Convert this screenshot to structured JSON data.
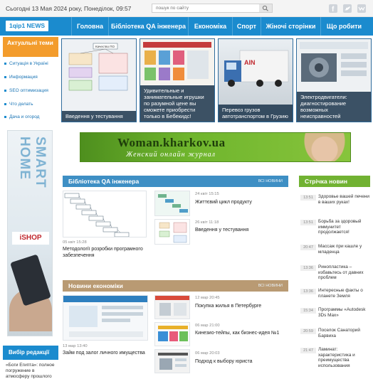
{
  "topbar": {
    "date": "Сьогодні 13 Мая 2024 року, Понеділок, 09:57",
    "search_placeholder": "пошук по сайту"
  },
  "nav": {
    "logo": "1qip1 NEWS",
    "items": [
      "Головна",
      "Бібліотека QA інженера",
      "Економіка",
      "Спорт",
      "Жіночі сторінки",
      "Що робити"
    ]
  },
  "sidebar": {
    "topics_title": "Актуальні теми",
    "topics": [
      "Ситуація в Україні",
      "Информация",
      "SEO оптимизация",
      "Что делать",
      "Дача и огород"
    ],
    "ad_text": "SMART HOME",
    "ad_brand": "iSHOP",
    "editor_title": "Вибір редакції",
    "editor_text": "«Боги Египта»: полное погружение в атмосферу прошлого"
  },
  "featured": [
    {
      "caption": "Введення у тестування",
      "chart_label": "Качество ПО"
    },
    {
      "caption": "Удивительные и занимательные игрушки по разумной цене вы сможете приобрести только в Бебекидс!"
    },
    {
      "caption": "Перевоз грузов автотранспортом в Грузию"
    },
    {
      "caption": "Электродвигатели: диагностирование возможных неисправностей"
    }
  ],
  "banner": {
    "title": "Woman.kharkov.ua",
    "subtitle": "Женский онлайн журнал"
  },
  "qa_section": {
    "title": "Бібліотека QA інженера",
    "all_link": "ВСІ НОВИНИ",
    "main": {
      "meta": "05 квіт 15:28",
      "title": "Методології розробки програмного забезпечення"
    },
    "items": [
      {
        "meta": "24 квіт 15:15",
        "title": "Життєвий цикл продукту"
      },
      {
        "meta": "26 квіт 11:18",
        "title": "Введення у тестування"
      }
    ]
  },
  "eco_section": {
    "title": "Новини економіки",
    "all_link": "ВСІ НОВИНИ",
    "main": {
      "meta": "13 мар 13:40",
      "title": "Займ под залог личного имущества"
    },
    "items": [
      {
        "meta": "12 мар 20:45",
        "title": "Покупка жилья в Петербурге"
      },
      {
        "meta": "06 мар 21:00",
        "title": "Кинезио-тейпы, как бизнес-идея №1"
      },
      {
        "meta": "06 мар 20:03",
        "title": "Подход к выбору юриста"
      }
    ]
  },
  "news_feed": {
    "title": "Стрічка новин",
    "items": [
      {
        "time": "13:51",
        "text": "Здоровье вашей печени в ваших руках!"
      },
      {
        "time": "13:51",
        "text": "Борьба за здоровый иммунитет продолжается!"
      },
      {
        "time": "20:47",
        "text": "Массаж при кашле у младенца"
      },
      {
        "time": "13:36",
        "text": "Ринопластика – избавьтесь от давних проблем"
      },
      {
        "time": "13:36",
        "text": "Интересные факты о планете Земля"
      },
      {
        "time": "15:34",
        "text": "Программы «Autodesk 3Ds Max»"
      },
      {
        "time": "20:59",
        "text": "Поселок Санаторий Барвиха"
      },
      {
        "time": "21:47",
        "text": "Ламинат: характеристика и преимущества использования"
      }
    ]
  },
  "colors": {
    "nav_blue": "#1b8bce",
    "topics_orange": "#f39c2c",
    "news_green": "#71b232",
    "eco_tan": "#b99a73"
  }
}
